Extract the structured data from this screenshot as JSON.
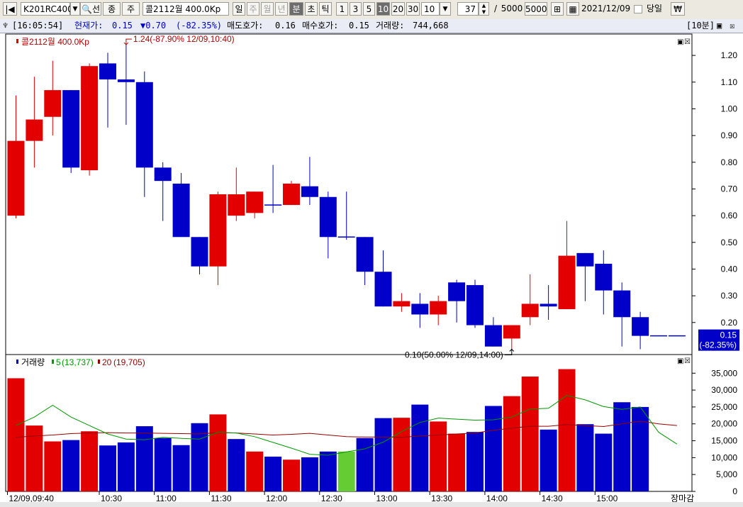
{
  "toolbar": {
    "symbol": "K201RC400",
    "btn_select": "선",
    "btn_prev": "종",
    "btn_next": "주",
    "item_name": "콜2112월 400.0Kp",
    "periods": [
      "일",
      "주",
      "월",
      "년",
      "분",
      "초",
      "틱"
    ],
    "active_period": "분",
    "intervals": [
      "1",
      "3",
      "5",
      "10",
      "20",
      "30"
    ],
    "active_interval": "10",
    "interval_select": "10",
    "count": "37",
    "count_sep": "/",
    "count_max": "5000",
    "count_max_box": "5000",
    "date": "2021/12/09",
    "same_day_label": "당일",
    "currency_icon": "₩"
  },
  "info": {
    "time": "[16:05:54]",
    "current_label": "현재가:",
    "current_value": "0.15",
    "change": "▼0.70",
    "change_pct": "(-82.35%)",
    "ask_label": "매도호가:",
    "ask_value": "0.16",
    "bid_label": "매수호가:",
    "bid_value": "0.15",
    "volume_label": "거래량:",
    "volume_value": "744,668",
    "period_tag": "[10분]"
  },
  "colors": {
    "up": "#e30000",
    "down": "#0000c8",
    "highlight": "#66cc33",
    "ma5": "#009900",
    "ma20": "#990000"
  },
  "chart_data": [
    {
      "type": "candlestick",
      "title": "콜2112월 400.0Kp",
      "categories": [
        "09:40",
        "09:50",
        "10:00",
        "10:10",
        "10:20",
        "10:30",
        "10:40",
        "10:50",
        "11:00",
        "11:10",
        "11:20",
        "11:30",
        "11:40",
        "11:50",
        "12:00",
        "12:10",
        "12:20",
        "12:30",
        "12:40",
        "12:50",
        "13:00",
        "13:10",
        "13:20",
        "13:30",
        "13:40",
        "13:50",
        "14:00",
        "14:10",
        "14:20",
        "14:30",
        "14:40",
        "14:50",
        "15:00",
        "15:10",
        "15:20",
        "15:30",
        "15:40"
      ],
      "open": [
        0.6,
        0.88,
        0.97,
        1.07,
        0.77,
        1.17,
        1.11,
        1.1,
        0.78,
        0.72,
        0.52,
        0.41,
        0.6,
        0.61,
        0.64,
        0.64,
        0.71,
        0.67,
        0.52,
        0.52,
        0.39,
        0.26,
        0.27,
        0.23,
        0.35,
        0.34,
        0.19,
        0.14,
        0.22,
        0.27,
        0.25,
        0.46,
        0.42,
        0.32,
        0.22,
        0.15,
        0.15
      ],
      "close": [
        0.88,
        0.96,
        1.07,
        0.78,
        1.16,
        1.11,
        1.1,
        0.78,
        0.73,
        0.52,
        0.41,
        0.68,
        0.68,
        0.69,
        0.64,
        0.72,
        0.67,
        0.52,
        0.52,
        0.39,
        0.26,
        0.28,
        0.23,
        0.28,
        0.28,
        0.19,
        0.11,
        0.19,
        0.27,
        0.26,
        0.45,
        0.41,
        0.32,
        0.22,
        0.15,
        0.15,
        0.15
      ],
      "high": [
        1.05,
        1.12,
        1.18,
        1.07,
        1.17,
        1.21,
        1.24,
        1.14,
        0.8,
        0.76,
        0.52,
        0.69,
        0.78,
        0.69,
        0.79,
        0.73,
        0.82,
        0.69,
        0.69,
        0.52,
        0.47,
        0.31,
        0.31,
        0.3,
        0.36,
        0.36,
        0.22,
        0.18,
        0.38,
        0.34,
        0.58,
        0.46,
        0.47,
        0.35,
        0.24,
        0.15,
        0.15
      ],
      "low": [
        0.59,
        0.78,
        0.9,
        0.76,
        0.75,
        0.93,
        0.94,
        0.67,
        0.58,
        0.58,
        0.38,
        0.34,
        0.58,
        0.59,
        0.61,
        0.64,
        0.64,
        0.44,
        0.51,
        0.34,
        0.26,
        0.24,
        0.18,
        0.19,
        0.2,
        0.18,
        0.11,
        0.1,
        0.19,
        0.21,
        0.25,
        0.28,
        0.23,
        0.11,
        0.1,
        0.15,
        0.15
      ],
      "yticks": [
        0.2,
        0.3,
        0.4,
        0.5,
        0.6,
        0.7,
        0.8,
        0.9,
        1.0,
        1.1,
        1.2
      ],
      "ylim": [
        0.08,
        1.28
      ],
      "last_price": "0.15",
      "last_change": "(-82.35%)",
      "max_annotation": "1.24(-87.90% 12/09,10:40)",
      "min_annotation": "0.10(50.00% 12/09,14:00)"
    },
    {
      "type": "bar",
      "title": "거래량",
      "legend": [
        {
          "name": "5",
          "value": "(13,737)"
        },
        {
          "name": "20",
          "value": "(19,705)"
        }
      ],
      "categories": [
        "09:40",
        "09:50",
        "10:00",
        "10:10",
        "10:20",
        "10:30",
        "10:40",
        "10:50",
        "11:00",
        "11:10",
        "11:20",
        "11:30",
        "11:40",
        "11:50",
        "12:00",
        "12:10",
        "12:20",
        "12:30",
        "12:40",
        "12:50",
        "13:00",
        "13:10",
        "13:20",
        "13:30",
        "13:40",
        "13:50",
        "14:00",
        "14:10",
        "14:20",
        "14:30",
        "14:40",
        "14:50",
        "15:00",
        "15:10",
        "15:20",
        "15:30",
        "15:40"
      ],
      "values": [
        33500,
        19500,
        14800,
        15200,
        17800,
        13600,
        14500,
        19300,
        15800,
        13700,
        20200,
        22800,
        15500,
        11800,
        10300,
        9400,
        10100,
        11800,
        11800,
        15800,
        21700,
        21800,
        25700,
        20700,
        17100,
        17600,
        25300,
        28200,
        34000,
        18300,
        36200,
        19900,
        17100,
        26400,
        25000
      ],
      "colors_key": [
        "up",
        "up",
        "up",
        "down",
        "up",
        "down",
        "down",
        "down",
        "down",
        "down",
        "down",
        "up",
        "down",
        "up",
        "down",
        "up",
        "down",
        "down",
        "highlight",
        "down",
        "down",
        "up",
        "down",
        "up",
        "up",
        "down",
        "down",
        "up",
        "up",
        "down",
        "up",
        "down",
        "down",
        "down",
        "down"
      ],
      "ma5": [
        19500,
        22000,
        25500,
        22000,
        19500,
        17000,
        15500,
        15300,
        16000,
        15700,
        15500,
        17500,
        17300,
        16200,
        14500,
        12800,
        11000,
        10700,
        11700,
        12600,
        14600,
        17700,
        20400,
        21700,
        21400,
        21100,
        21200,
        22000,
        24400,
        24600,
        28400,
        27100,
        25100,
        24300,
        25000,
        17500,
        14000
      ],
      "ma20": [
        16000,
        16400,
        16700,
        17100,
        17300,
        17400,
        17300,
        17300,
        17200,
        17100,
        17000,
        17400,
        17300,
        17000,
        16700,
        16900,
        17200,
        16700,
        16200,
        16100,
        16100,
        16000,
        16400,
        16700,
        17000,
        17300,
        18100,
        18700,
        19300,
        19300,
        19800,
        19500,
        19200,
        20000,
        20800,
        20000,
        19500
      ],
      "yticks": [
        0,
        5000,
        10000,
        15000,
        20000,
        25000,
        30000,
        35000
      ],
      "ylim": [
        0,
        38000
      ],
      "ytick_labels": [
        "0",
        "5,000",
        "10,000",
        "15,000",
        "20,000",
        "25,000",
        "30,000",
        "35,000"
      ]
    }
  ],
  "time_axis": {
    "labels": [
      "12/09,09:40",
      "10:30",
      "11:00",
      "11:30",
      "12:00",
      "12:30",
      "13:00",
      "13:30",
      "14:00",
      "14:30",
      "15:00"
    ],
    "label_index": [
      0,
      5,
      8,
      11,
      14,
      17,
      20,
      23,
      26,
      29,
      32
    ],
    "end_label": "장마감"
  }
}
